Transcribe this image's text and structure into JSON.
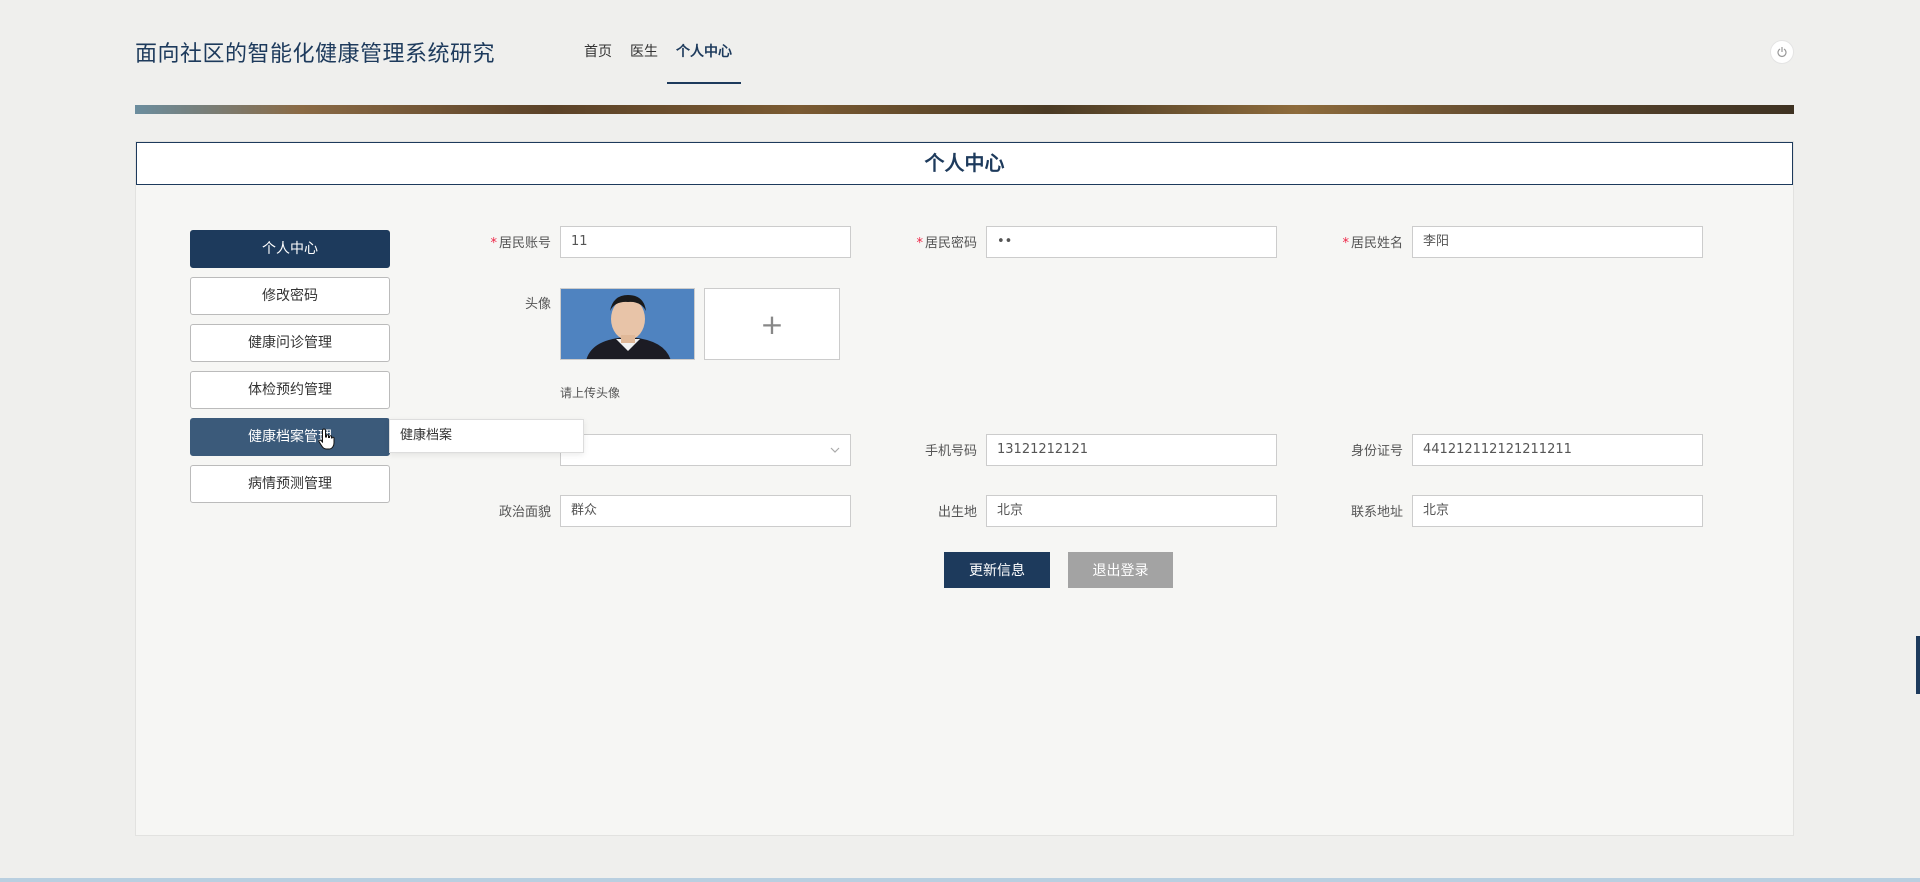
{
  "header": {
    "site_title": "面向社区的智能化健康管理系统研究",
    "nav": [
      "首页",
      "医生",
      "个人中心"
    ]
  },
  "panel": {
    "title": "个人中心"
  },
  "sidebar": {
    "items": [
      {
        "label": "个人中心"
      },
      {
        "label": "修改密码"
      },
      {
        "label": "健康问诊管理"
      },
      {
        "label": "体检预约管理"
      },
      {
        "label": "健康档案管理"
      },
      {
        "label": "病情预测管理"
      }
    ],
    "dropdown_item": "健康档案"
  },
  "form": {
    "account_label": "居民账号",
    "account_value": "11",
    "password_label": "居民密码",
    "password_value": "••",
    "name_label": "居民姓名",
    "name_value": "李阳",
    "avatar_label": "头像",
    "upload_plus": "+",
    "upload_hint": "请上传头像",
    "gender_value": "",
    "phone_label": "手机号码",
    "phone_value": "13121212121",
    "id_label": "身份证号",
    "id_value": "441212112121211211",
    "politics_label": "政治面貌",
    "politics_value": "群众",
    "birthplace_label": "出生地",
    "birthplace_value": "北京",
    "address_label": "联系地址",
    "address_value": "北京",
    "update_button": "更新信息",
    "logout_button": "退出登录"
  },
  "colors": {
    "primary": "#1d3a5c",
    "required": "#e24",
    "secondary_button": "#a3a3a3"
  }
}
